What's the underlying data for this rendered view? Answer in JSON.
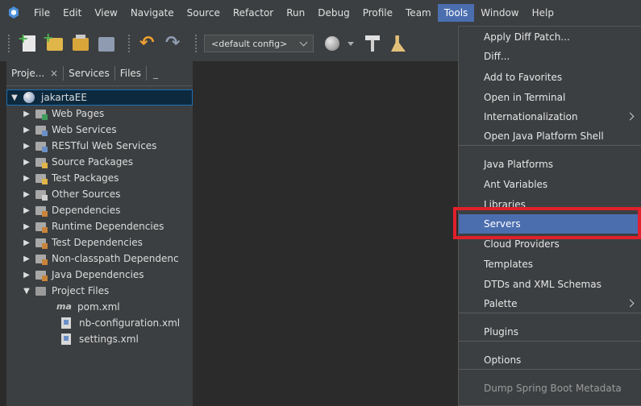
{
  "menubar": {
    "items": [
      "File",
      "Edit",
      "View",
      "Navigate",
      "Source",
      "Refactor",
      "Run",
      "Debug",
      "Profile",
      "Team",
      "Tools",
      "Window",
      "Help"
    ],
    "active": "Tools"
  },
  "toolbar": {
    "config_value": "<default config>",
    "icons": [
      "new-file-icon",
      "new-project-icon",
      "open-project-icon",
      "save-all-icon",
      "undo-icon",
      "redo-icon",
      "globe-icon",
      "build-icon",
      "clean-build-icon"
    ]
  },
  "projects_panel": {
    "tabs": [
      "Proje...",
      "Services",
      "Files"
    ],
    "close_glyph": "×",
    "minimize_glyph": "_",
    "root": "jakartaEE",
    "nodes": [
      {
        "label": "Web Pages",
        "badge": "#3f9c5a"
      },
      {
        "label": "Web Services",
        "badge": "#6a8fc6"
      },
      {
        "label": "RESTful Web Services",
        "badge": "#6a8fc6"
      },
      {
        "label": "Source Packages",
        "badge": "#e0b54a"
      },
      {
        "label": "Test Packages",
        "badge": "#e0b54a"
      },
      {
        "label": "Other Sources",
        "badge": "#d0d0d0"
      },
      {
        "label": "Dependencies",
        "badge": "#c9843a"
      },
      {
        "label": "Runtime Dependencies",
        "badge": "#c9843a"
      },
      {
        "label": "Test Dependencies",
        "badge": "#c9843a"
      },
      {
        "label": "Non-classpath Dependenc",
        "badge": "#c9843a"
      },
      {
        "label": "Java Dependencies",
        "badge": "#c9843a"
      }
    ],
    "project_files": {
      "label": "Project Files",
      "files": [
        {
          "label": "pom.xml",
          "icon": "maven-icon",
          "glyph": "ma"
        },
        {
          "label": "nb-configuration.xml",
          "icon": "xml-file-icon"
        },
        {
          "label": "settings.xml",
          "icon": "xml-file-icon"
        }
      ]
    }
  },
  "tools_menu": {
    "items": [
      {
        "label": "Apply Diff Patch...",
        "submenu": false
      },
      {
        "label": "Diff...",
        "submenu": false
      },
      {
        "label": "Add to Favorites",
        "submenu": false
      },
      {
        "label": "Open in Terminal",
        "submenu": false
      },
      {
        "label": "Internationalization",
        "submenu": true
      },
      {
        "label": "Open Java Platform Shell",
        "submenu": false
      },
      {
        "label": "Java Platforms",
        "submenu": false
      },
      {
        "label": "Ant Variables",
        "submenu": false
      },
      {
        "label": "Libraries",
        "submenu": false
      },
      {
        "label": "Servers",
        "submenu": false,
        "highlighted": true
      },
      {
        "label": "Cloud Providers",
        "submenu": false
      },
      {
        "label": "Templates",
        "submenu": false
      },
      {
        "label": "DTDs and XML Schemas",
        "submenu": false
      },
      {
        "label": "Palette",
        "submenu": true
      },
      {
        "label": "Plugins",
        "submenu": false
      },
      {
        "label": "Options",
        "submenu": false
      },
      {
        "label": "Dump Spring Boot Metadata",
        "submenu": false,
        "disabled": true
      }
    ],
    "annotation_color": "#e0202a"
  }
}
